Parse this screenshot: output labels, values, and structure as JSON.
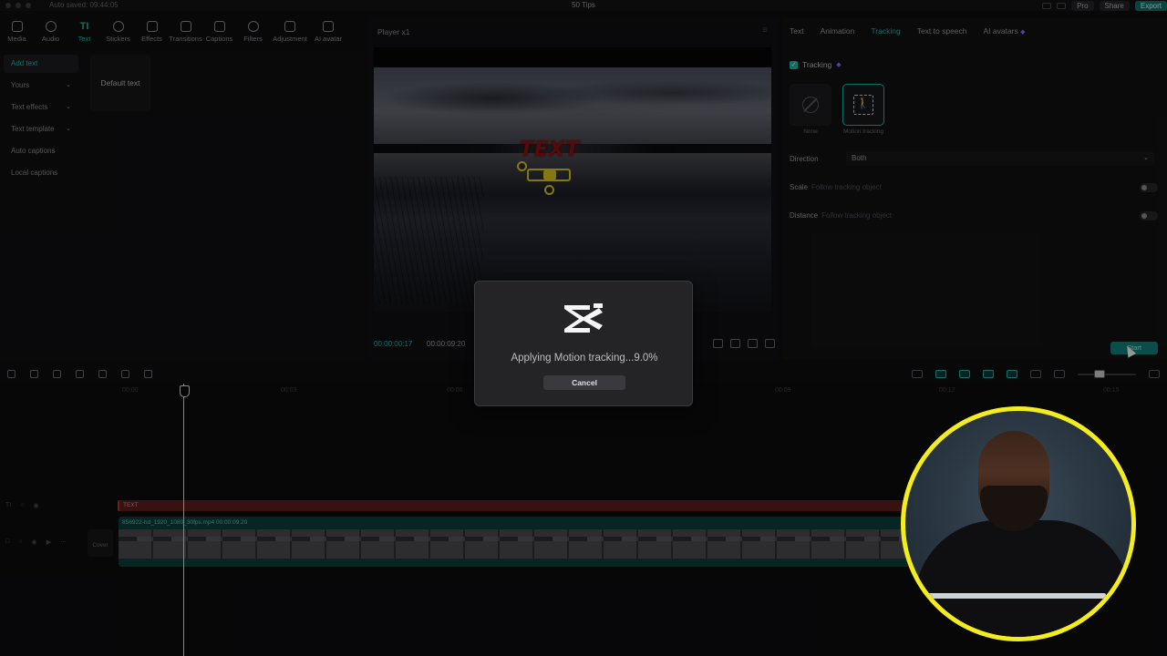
{
  "titlebar": {
    "autosave": "Auto saved: 09:44:05",
    "title": "50 Tips",
    "pro_label": "Pro",
    "share_label": "Share",
    "export_label": "Export"
  },
  "toolbar": {
    "items": [
      {
        "label": "Media"
      },
      {
        "label": "Audio"
      },
      {
        "label": "Text"
      },
      {
        "label": "Stickers"
      },
      {
        "label": "Effects"
      },
      {
        "label": "Transitions"
      },
      {
        "label": "Captions"
      },
      {
        "label": "Filters"
      },
      {
        "label": "Adjustment"
      },
      {
        "label": "AI avatar"
      }
    ],
    "text_glyph": "TI"
  },
  "leftnav": {
    "items": [
      {
        "label": "Add text"
      },
      {
        "label": "Yours"
      },
      {
        "label": "Text effects"
      },
      {
        "label": "Text template"
      },
      {
        "label": "Auto captions"
      },
      {
        "label": "Local captions"
      }
    ],
    "default_text": "Default text"
  },
  "player": {
    "title": "Player x1",
    "overlay_text": "TEXT",
    "current_time": "00:00:00:17",
    "duration": "00:00:09:20"
  },
  "rightpanel": {
    "tabs": [
      {
        "label": "Text"
      },
      {
        "label": "Animation"
      },
      {
        "label": "Tracking"
      },
      {
        "label": "Text to speech"
      },
      {
        "label": "AI avatars"
      }
    ],
    "tracking_label": "Tracking",
    "option_none": "None",
    "option_motion": "Motion tracking",
    "direction_label": "Direction",
    "direction_value": "Both",
    "scale_label": "Scale",
    "scale_sub": "Follow tracking object",
    "distance_label": "Distance",
    "distance_sub": "Follow tracking object",
    "start_label": "Start"
  },
  "timeline": {
    "ruler": [
      "00:00",
      "00:03",
      "00:06",
      "00:09",
      "00:12",
      "00:15"
    ],
    "text_clip": "TEXT",
    "video_clip": "856922-hd_1920_1080_30fps.mp4   00:00:09:20",
    "cover_label": "Cover"
  },
  "modal": {
    "message": "Applying Motion tracking...9.0%",
    "cancel_label": "Cancel"
  }
}
